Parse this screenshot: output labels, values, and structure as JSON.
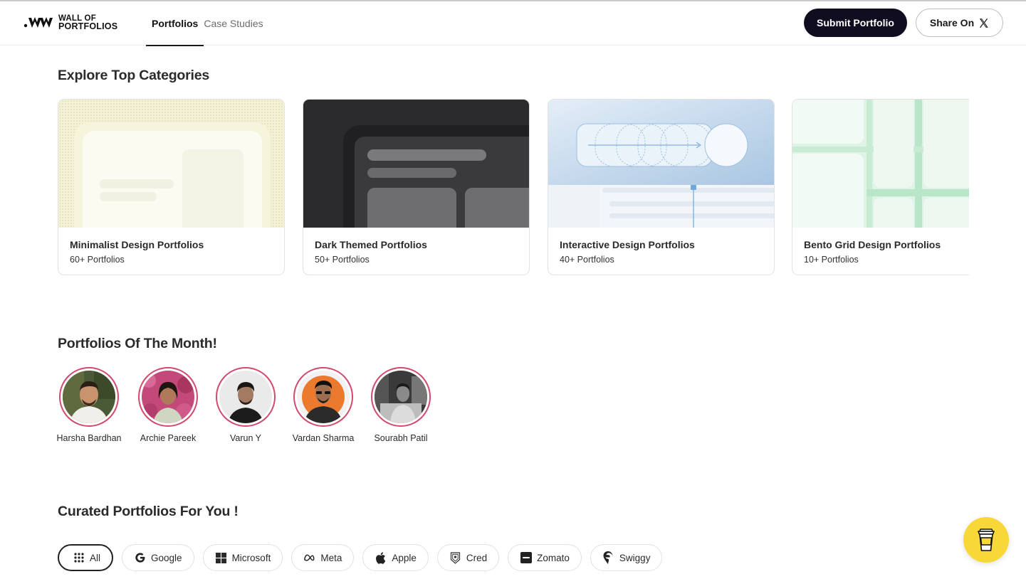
{
  "brand": {
    "line1": "WALL OF",
    "line2": "PORTFOLIOS"
  },
  "nav": {
    "tabs": [
      {
        "label": "Portfolios",
        "active": true
      },
      {
        "label": "Case Studies",
        "active": false
      }
    ],
    "submit_label": "Submit Portfolio",
    "share_label": "Share On",
    "share_icon": "x-logo-icon"
  },
  "sections": {
    "categories_title": "Explore Top Categories",
    "month_title": "Portfolios Of The Month!",
    "curated_title": "Curated Portfolios For You !"
  },
  "categories": [
    {
      "title": "Minimalist Design Portfolios",
      "count": "60+ Portfolios"
    },
    {
      "title": "Dark Themed Portfolios",
      "count": "50+ Portfolios"
    },
    {
      "title": "Interactive Design Portfolios",
      "count": "40+ Portfolios"
    },
    {
      "title": "Bento Grid Design Portfolios",
      "count": "10+ Portfolios"
    }
  ],
  "month": [
    {
      "name": "Harsha Bardhan"
    },
    {
      "name": "Archie Pareek"
    },
    {
      "name": "Varun Y"
    },
    {
      "name": "Vardan Sharma"
    },
    {
      "name": "Sourabh Patil"
    }
  ],
  "filters": [
    {
      "label": "All",
      "icon": "grid-dots-icon",
      "active": true
    },
    {
      "label": "Google",
      "icon": "google-icon",
      "active": false
    },
    {
      "label": "Microsoft",
      "icon": "microsoft-icon",
      "active": false
    },
    {
      "label": "Meta",
      "icon": "meta-icon",
      "active": false
    },
    {
      "label": "Apple",
      "icon": "apple-icon",
      "active": false
    },
    {
      "label": "Cred",
      "icon": "cred-icon",
      "active": false
    },
    {
      "label": "Zomato",
      "icon": "zomato-icon",
      "active": false
    },
    {
      "label": "Swiggy",
      "icon": "swiggy-icon",
      "active": false
    }
  ],
  "colors": {
    "primary_button": "#0f0d1f",
    "avatar_ring": "#d24a6c",
    "coffee_button": "#f8d839"
  }
}
